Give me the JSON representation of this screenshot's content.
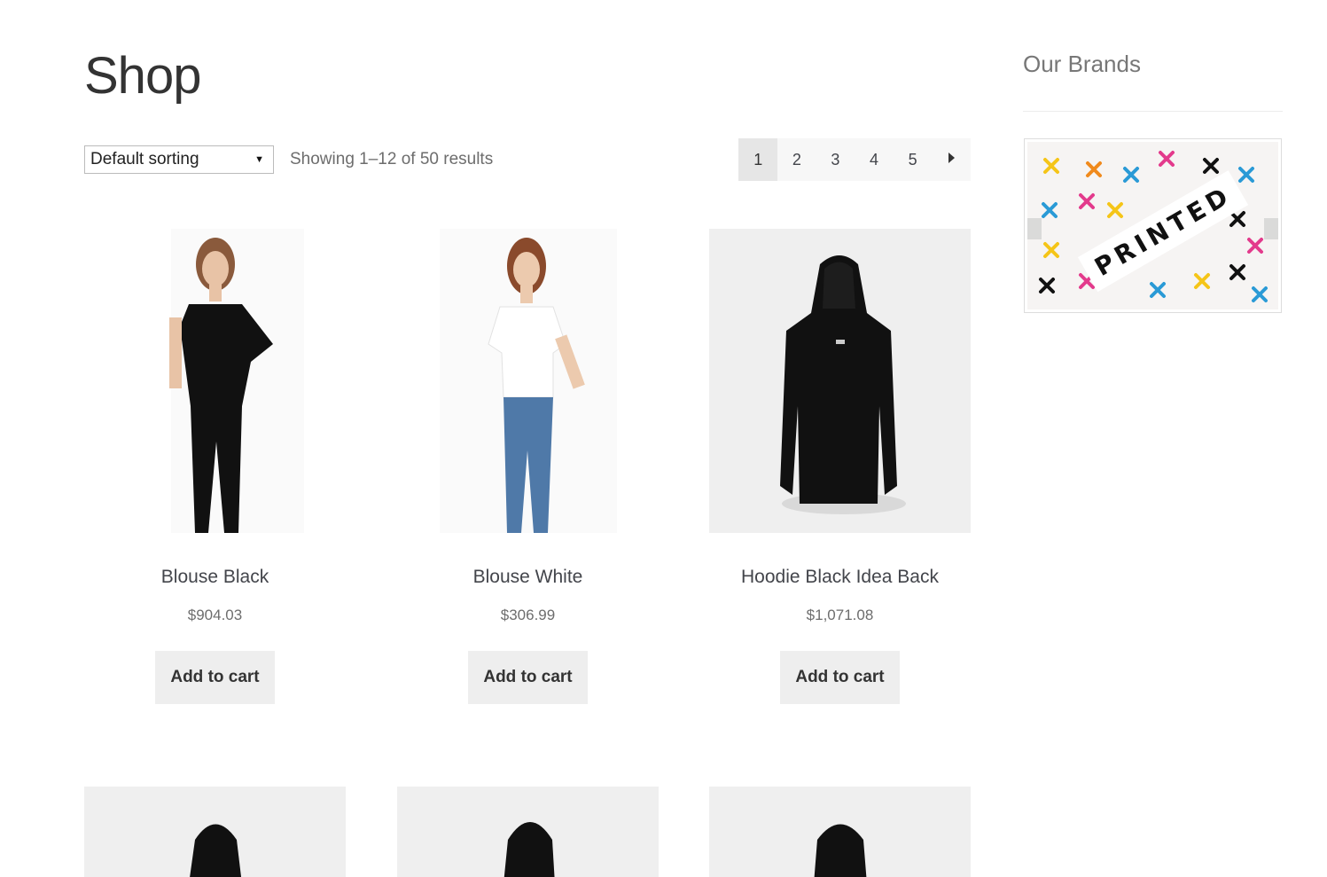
{
  "page": {
    "title": "Shop"
  },
  "toolbar": {
    "sort_selected": "Default sorting",
    "result_count": "Showing 1–12 of 50 results"
  },
  "pagination": {
    "pages": [
      "1",
      "2",
      "3",
      "4",
      "5"
    ],
    "current": "1",
    "next": "next-arrow"
  },
  "products": [
    {
      "name": "Blouse Black",
      "price": "$904.03",
      "button": "Add to cart"
    },
    {
      "name": "Blouse White",
      "price": "$306.99",
      "button": "Add to cart"
    },
    {
      "name": "Hoodie Black Idea Back",
      "price": "$1,071.08",
      "button": "Add to cart"
    }
  ],
  "sidebar": {
    "title": "Our Brands",
    "brand_logo_text": "PRINTED"
  }
}
